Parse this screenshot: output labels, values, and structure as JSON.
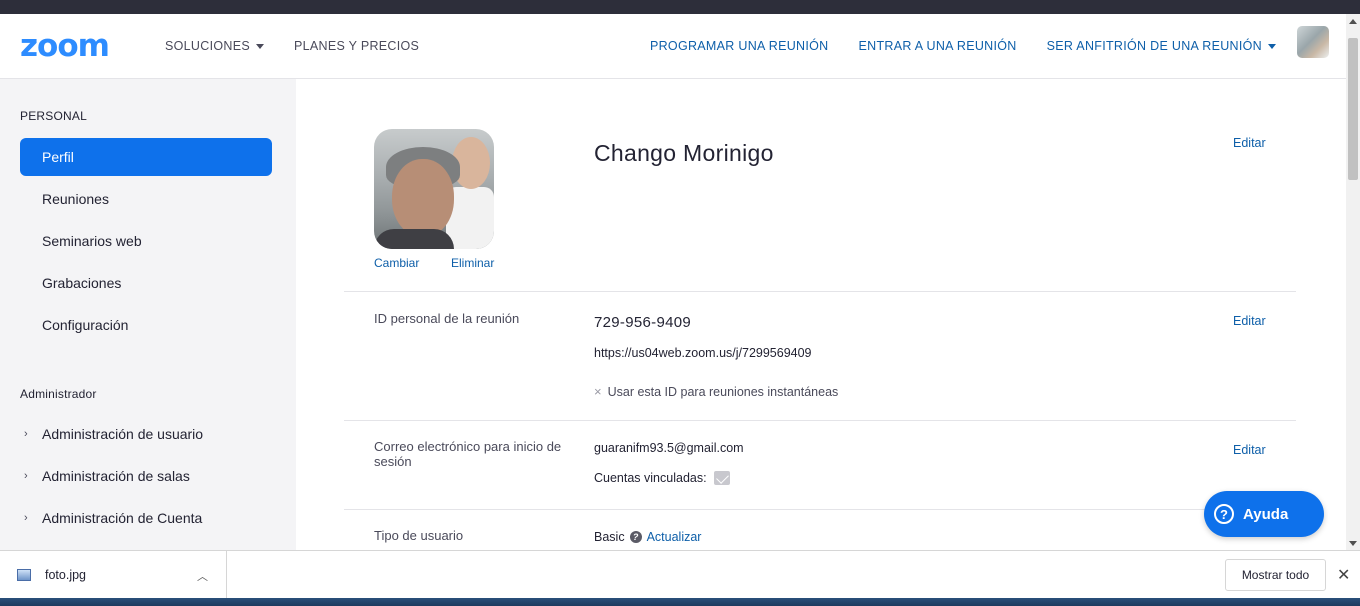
{
  "header": {
    "logo": "zoom",
    "nav_left": [
      {
        "label": "SOLUCIONES",
        "has_caret": true
      },
      {
        "label": "PLANES Y PRECIOS",
        "has_caret": false
      }
    ],
    "nav_right": [
      {
        "label": "PROGRAMAR UNA REUNIÓN"
      },
      {
        "label": "ENTRAR A UNA REUNIÓN"
      },
      {
        "label": "SER ANFITRIÓN DE UNA REUNIÓN"
      }
    ]
  },
  "sidebar": {
    "personal_title": "PERSONAL",
    "personal_items": [
      "Perfil",
      "Reuniones",
      "Seminarios web",
      "Grabaciones",
      "Configuración"
    ],
    "admin_title": "Administrador",
    "admin_items": [
      "Administración de usuario",
      "Administración de salas",
      "Administración de Cuenta"
    ]
  },
  "profile": {
    "change_label": "Cambiar",
    "delete_label": "Eliminar",
    "name": "Chango Morinigo",
    "edit_label": "Editar",
    "pmi_label": "ID personal de la reunión",
    "pmi_value": "729-956-9409",
    "pmi_url": "https://us04web.zoom.us/j/7299569409",
    "pmi_instant_label": "Usar esta ID para reuniones instantáneas",
    "email_label": "Correo electrónico para inicio de sesión",
    "email_value": "guaranifm93.5@gmail.com",
    "linked_accounts_label": "Cuentas vinculadas:",
    "user_type_label": "Tipo de usuario",
    "user_type_value": "Basic",
    "upgrade_label": "Actualizar"
  },
  "help": {
    "label": "Ayuda"
  },
  "downloads": {
    "file_name": "foto.jpg",
    "show_all_label": "Mostrar todo"
  },
  "colors": {
    "brand_blue": "#2d8cff",
    "active_blue": "#0e71eb",
    "link_blue": "#0e5fa9"
  }
}
